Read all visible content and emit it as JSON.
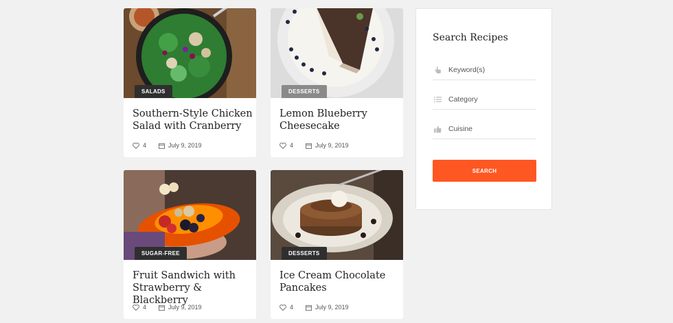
{
  "recipes": [
    {
      "category": "SALADS",
      "title": "Southern-Style Chicken Salad with Cranberry",
      "likes": "4",
      "date": "July 9, 2019"
    },
    {
      "category": "DESSERTS",
      "title": "Lemon Blueberry Cheesecake",
      "likes": "4",
      "date": "July 9, 2019"
    },
    {
      "category": "SUGAR-FREE",
      "title": "Fruit Sandwich with Strawberry & Blackberry",
      "likes": "4",
      "date": "July 9, 2019"
    },
    {
      "category": "DESSERTS",
      "title": "Ice Cream Chocolate Pancakes",
      "likes": "4",
      "date": "July 9, 2019"
    }
  ],
  "sidebar": {
    "heading": "Search Recipes",
    "keyword_placeholder": "Keyword(s)",
    "category_placeholder": "Category",
    "cuisine_placeholder": "Cuisine",
    "search_label": "SEARCH"
  },
  "colors": {
    "accent": "#ff5722",
    "badge_dark": "#2f2f2f",
    "badge_grey": "#8a8a8a"
  }
}
